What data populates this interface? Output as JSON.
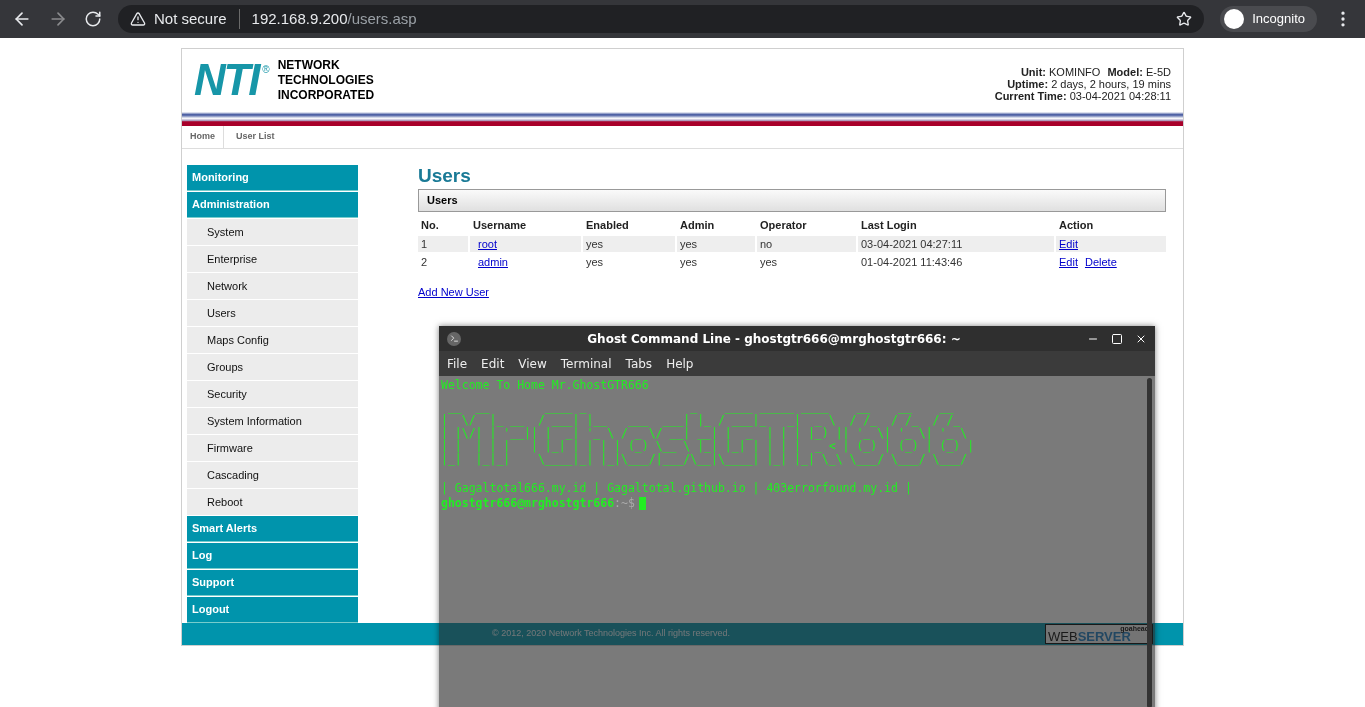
{
  "browser": {
    "security": "Not secure",
    "url": "192.168.9.200/users.asp",
    "profile": "Incognito"
  },
  "header": {
    "logo_mark": "NTI",
    "logo_reg": "®",
    "company": [
      "NETWORK",
      "TECHNOLOGIES",
      "INCORPORATED"
    ],
    "info": [
      {
        "label": "Unit:",
        "value": "KOMINFO",
        "label2": "Model:",
        "value2": "E-5D"
      },
      {
        "label": "Uptime:",
        "value": "2 days, 2 hours, 19 mins"
      },
      {
        "label": "Current Time:",
        "value": "03-04-2021 04:28:11"
      }
    ]
  },
  "breadcrumbs": [
    "Home",
    "User List"
  ],
  "sidebar": {
    "items": [
      {
        "label": "Monitoring"
      },
      {
        "label": "Administration",
        "children": [
          {
            "label": "System"
          },
          {
            "label": "Enterprise"
          },
          {
            "label": "Network"
          },
          {
            "label": "Users"
          },
          {
            "label": "Maps Config"
          },
          {
            "label": "Groups"
          },
          {
            "label": "Security"
          },
          {
            "label": "System Information"
          },
          {
            "label": "Firmware"
          },
          {
            "label": "Cascading"
          },
          {
            "label": "Reboot"
          }
        ]
      },
      {
        "label": "Smart Alerts"
      },
      {
        "label": "Log"
      },
      {
        "label": "Support"
      },
      {
        "label": "Logout"
      }
    ]
  },
  "page_title": "Users",
  "table": {
    "caption": "Users",
    "columns": [
      "No.",
      "Username",
      "Enabled",
      "Admin",
      "Operator",
      "Last Login",
      "Action"
    ],
    "rows": [
      {
        "no": "1",
        "username": "root",
        "enabled": "yes",
        "admin": "yes",
        "operator": "no",
        "last_login": "03-04-2021 04:27:11",
        "actions": [
          "Edit"
        ]
      },
      {
        "no": "2",
        "username": "admin",
        "enabled": "yes",
        "admin": "yes",
        "operator": "yes",
        "last_login": "01-04-2021 11:43:46",
        "actions": [
          "Edit",
          "Delete"
        ]
      }
    ]
  },
  "add_link": "Add New User",
  "footer": {
    "copyright": "© 2012, 2020 Network Technologies Inc. All rights reserved.",
    "badge_top": "goahead",
    "badge_left": "WEB",
    "badge_right": "SERVER"
  },
  "terminal": {
    "title": "Ghost Command Line - ghostgtr666@mrghostgtr666: ~",
    "menu": [
      "File",
      "Edit",
      "View",
      "Terminal",
      "Tabs",
      "Help"
    ],
    "welcome": "Welcome To Home Mr.GhostGTR666",
    "art": [
      " __  __        ____ _               _    ____ _____ ____    __    __    __",
      "|  \\/  |_ __  / ___| |__   ___  ___| |_ / ___|_   _|  _ \\  / /_  / /_  / /_",
      "| |\\/| | '__|| |  _| '_ \\ / _ \\/ __| __| |  _  | | | |_) || '_ \\| '_ \\| '_ \\",
      "| |  | | |   | |_| | | | | (_) \\__ \\ |_| |_| | | | |  _ < | (_) | (_) | (_) |",
      "|_|  |_|_|    \\____|_| |_|\\___/|___/\\__|\\____| |_| |_| \\_\\ \\___/ \\___/ \\___/"
    ],
    "links": "| Gagaltotal666.my.id | Gagaltotal.github.io | 403errorfound.my.id |",
    "prompt_user": "ghostgtr666@mrghostgtr666",
    "prompt_path": ":~$"
  }
}
